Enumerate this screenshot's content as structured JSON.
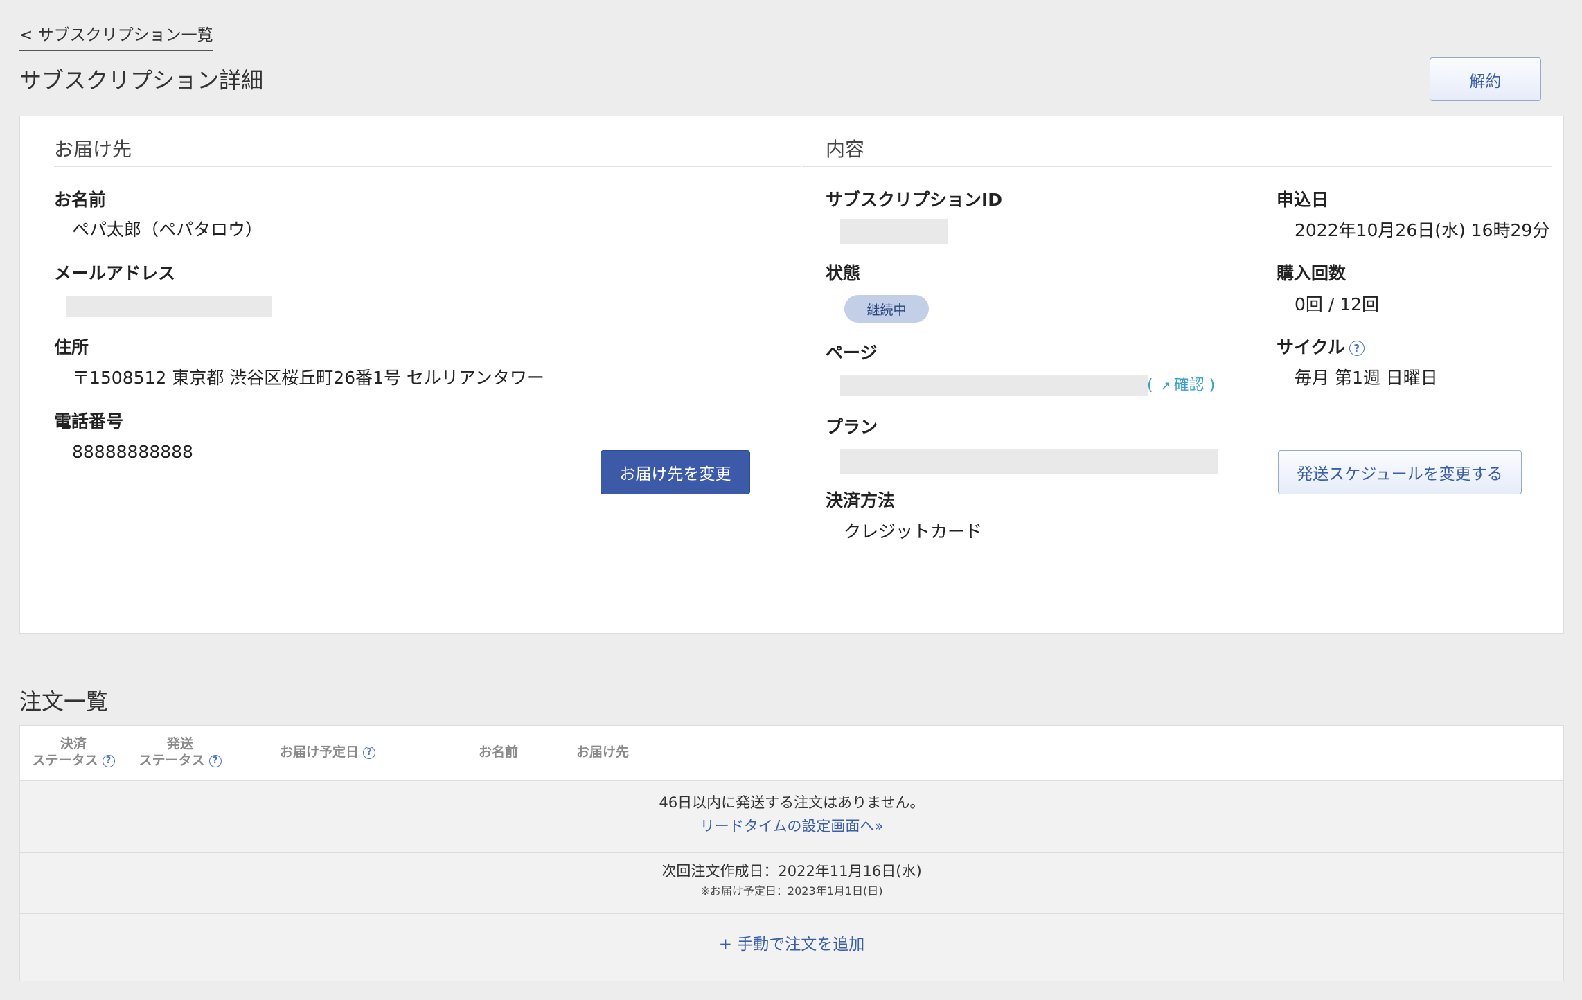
{
  "nav": {
    "back_label": "< サブスクリプション一覧"
  },
  "page": {
    "title": "サブスクリプション詳細",
    "cancel_label": "解約"
  },
  "delivery": {
    "heading": "お届け先",
    "name_label": "お名前",
    "name_value": "ペパ太郎（ペパタロウ）",
    "email_label": "メールアドレス",
    "address_label": "住所",
    "address_value": "〒1508512 東京都 渋谷区桜丘町26番1号 セルリアンタワー",
    "phone_label": "電話番号",
    "phone_value": "88888888888",
    "change_button": "お届け先を変更"
  },
  "content": {
    "heading": "内容",
    "subscription_id_label": "サブスクリプションID",
    "status_label": "状態",
    "status_badge": "継続中",
    "page_label": "ページ",
    "confirm_link": "確認",
    "plan_label": "プラン",
    "payment_label": "決済方法",
    "payment_value": "クレジットカード",
    "applied_label": "申込日",
    "applied_value": "2022年10月26日(水) 16時29分",
    "purchase_count_label": "購入回数",
    "purchase_count_value": "0回 / 12回",
    "cycle_label": "サイクル",
    "cycle_value": "毎月 第1週 日曜日",
    "schedule_button": "発送スケジュールを変更する"
  },
  "orders": {
    "title": "注文一覧",
    "columns": {
      "payment_status_line1": "決済",
      "payment_status_line2": "ステータス",
      "shipping_status_line1": "発送",
      "shipping_status_line2": "ステータス",
      "delivery_date": "お届け予定日",
      "name": "お名前",
      "destination": "お届け先"
    },
    "empty_message": "46日以内に発送する注文はありません。",
    "lead_time_link": "リードタイムの設定画面へ»",
    "next_order_date": "次回注文作成日：2022年11月16日(水)",
    "next_delivery_note": "※お届け予定日：2023年1月1日(日)",
    "add_order": "+ 手動で注文を追加"
  },
  "colors": {
    "accent": "#3c5aa8",
    "link": "#3b5fa5",
    "confirm_link": "#3aa0c7",
    "badge_bg": "#c3cfe7",
    "page_bg": "#ededed"
  },
  "icons": {
    "help": "question-circle-icon",
    "external_link": "external-link-icon"
  }
}
